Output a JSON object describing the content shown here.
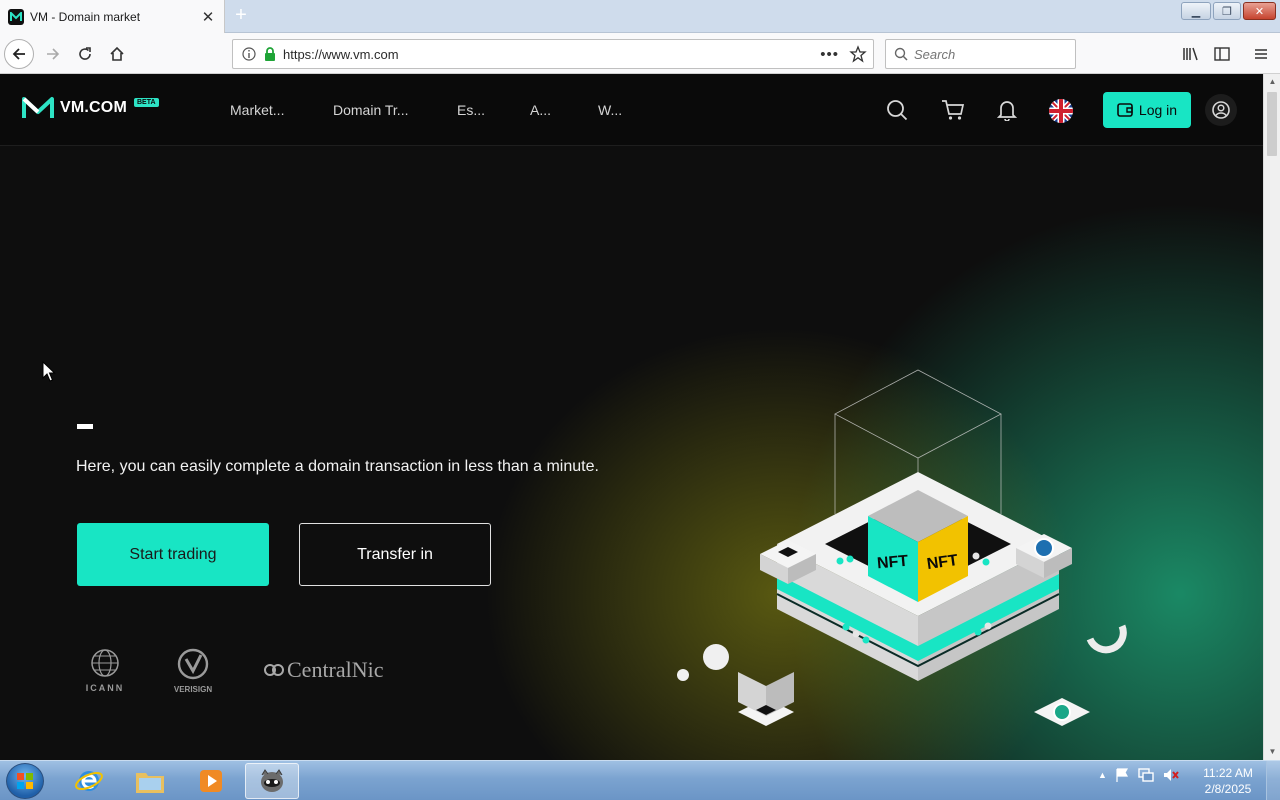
{
  "browser": {
    "tab_title": "VM - Domain market",
    "url": "https://www.vm.com",
    "search_placeholder": "Search"
  },
  "site": {
    "brand": "VM.COM",
    "beta": "BETA",
    "nav": [
      "Market...",
      "Domain Tr...",
      "Es...",
      "A...",
      "W..."
    ],
    "login": "Log in",
    "accent": "#18e5c4"
  },
  "hero": {
    "tagline": "Here, you can easily complete a domain transaction in less than a minute.",
    "primary_button": "Start trading",
    "secondary_button": "Transfer in",
    "cube_labels": [
      "NFT",
      "NFT"
    ]
  },
  "partners": [
    "ICANN",
    "VERISIGN",
    "CentralNic"
  ],
  "taskbar": {
    "time": "11:22 AM",
    "date": "2/8/2025"
  }
}
